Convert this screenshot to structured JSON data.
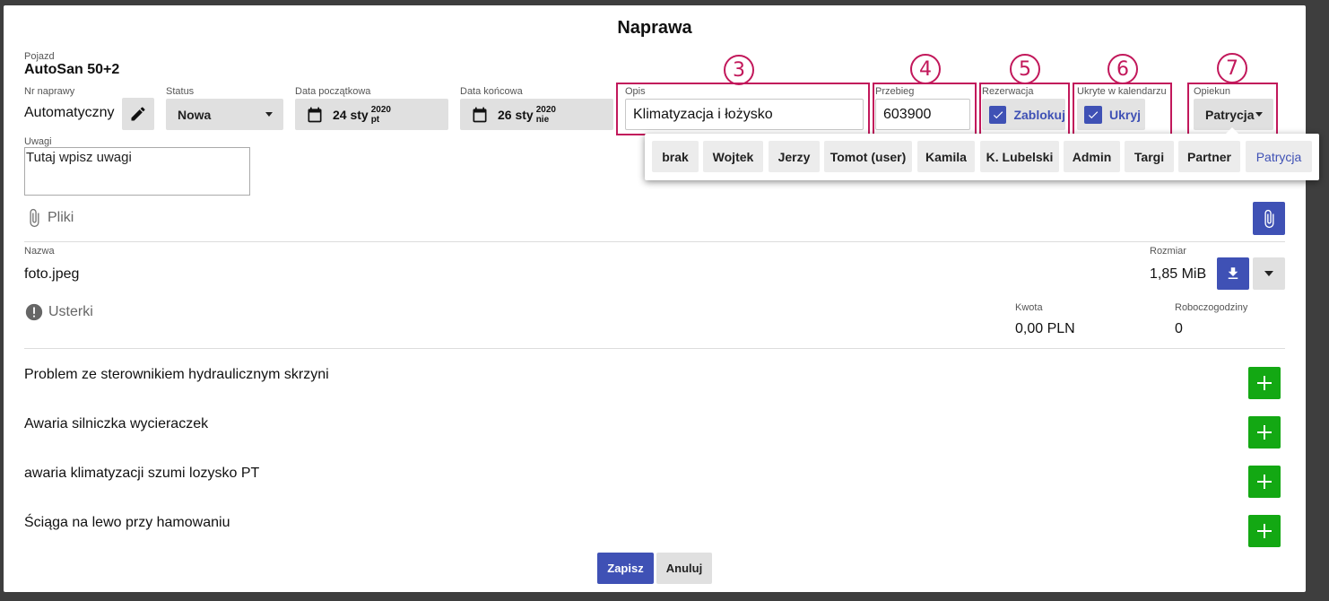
{
  "modal": {
    "title": "Naprawa"
  },
  "vehicle": {
    "label": "Pojazd",
    "value": "AutoSan 50+2"
  },
  "repair_number": {
    "label": "Nr naprawy",
    "value": "Automatyczny"
  },
  "status": {
    "label": "Status",
    "value": "Nowa"
  },
  "start_date": {
    "label": "Data początkowa",
    "day": "24 sty",
    "year": "2020",
    "weekday": "pt"
  },
  "end_date": {
    "label": "Data końcowa",
    "day": "26 sty",
    "year": "2020",
    "weekday": "nie"
  },
  "description": {
    "label": "Opis",
    "value": "Klimatyzacja i łożysko"
  },
  "mileage": {
    "label": "Przebieg",
    "value": "603900"
  },
  "reservation": {
    "label": "Rezerwacja",
    "checkbox_label": "Zablokuj",
    "checked": true
  },
  "hidden_calendar": {
    "label": "Ukryte w kalendarzu",
    "checkbox_label": "Ukryj",
    "checked": true
  },
  "guardian": {
    "label": "Opiekun",
    "value": "Patrycja",
    "options": [
      "brak",
      "Wojtek",
      "Jerzy",
      "Tomot (user)",
      "Kamila",
      "K. Lubelski",
      "Admin",
      "Targi",
      "Partner",
      "Patrycja"
    ],
    "selected": "Patrycja"
  },
  "annotations": [
    "3",
    "4",
    "5",
    "6",
    "7"
  ],
  "notes": {
    "label": "Uwagi",
    "placeholder": "Tutaj wpisz uwagi"
  },
  "files": {
    "section_label": "Pliki",
    "name_header": "Nazwa",
    "size_header": "Rozmiar",
    "rows": [
      {
        "name": "foto.jpeg",
        "size": "1,85 MiB"
      }
    ]
  },
  "defects": {
    "section_label": "Usterki",
    "amount_label": "Kwota",
    "amount_value": "0,00 PLN",
    "hours_label": "Roboczogodziny",
    "hours_value": "0",
    "items": [
      "Problem ze sterownikiem hydraulicznym skrzyni",
      "Awaria silniczka wycieraczek",
      "awaria klimatyzacji szumi lozysko PT",
      "Ściąga na lewo przy hamowaniu"
    ]
  },
  "actions": {
    "save": "Zapisz",
    "cancel": "Anuluj"
  },
  "colors": {
    "accent": "#3f51b5",
    "highlight": "#c2185b",
    "add": "#13a813"
  }
}
